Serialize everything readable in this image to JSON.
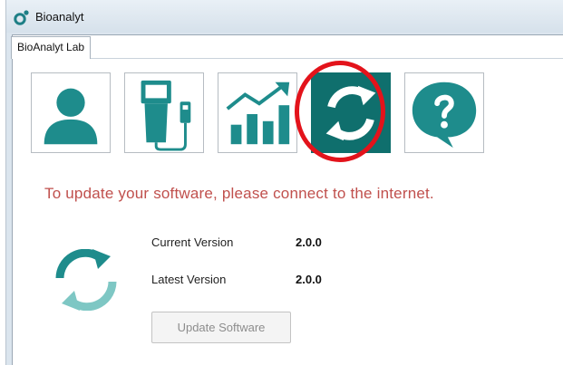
{
  "window": {
    "title": "Bioanalyt",
    "icon": "bioanalyt-logo-icon"
  },
  "tabs": [
    {
      "label": "BioAnalyt Lab",
      "selected": true
    }
  ],
  "toolbar": {
    "buttons": [
      {
        "icon": "user-profile-icon",
        "active": false
      },
      {
        "icon": "device-connection-icon",
        "active": false
      },
      {
        "icon": "statistics-chart-icon",
        "active": false
      },
      {
        "icon": "software-update-icon",
        "active": true,
        "highlighted": true
      },
      {
        "icon": "help-question-icon",
        "active": false
      }
    ]
  },
  "update_page": {
    "warning": "To update your software, please connect to the internet.",
    "current_version_label": "Current Version",
    "current_version": "2.0.0",
    "latest_version_label": "Latest Version",
    "latest_version": "2.0.0",
    "update_button_label": "Update Software",
    "update_button_enabled": false
  },
  "colors": {
    "accent_teal": "#1e8c8c",
    "warning_red": "#c0504d",
    "highlight_ring": "#e3131b",
    "active_button_bg": "#0f6f6d"
  }
}
